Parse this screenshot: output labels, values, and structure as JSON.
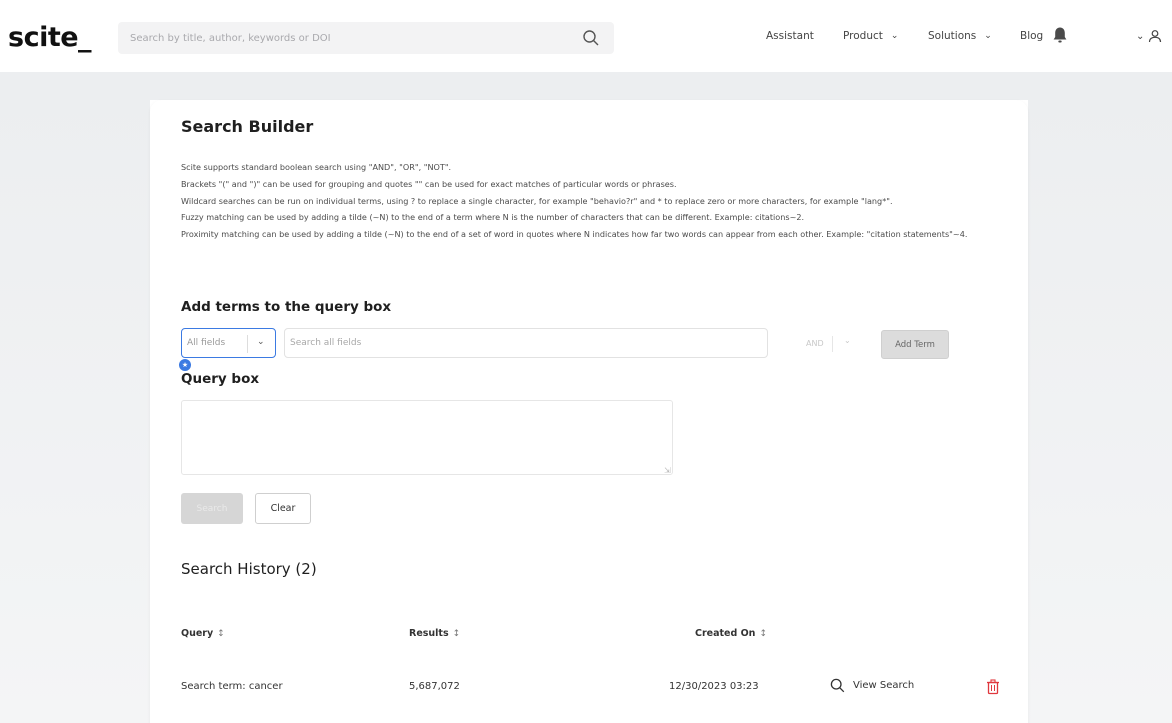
{
  "header": {
    "logo": "scite_",
    "search_placeholder": "Search by title, author, keywords or DOI",
    "nav": [
      {
        "label": "Assistant"
      },
      {
        "label": "Product",
        "chevron": true
      },
      {
        "label": "Solutions",
        "chevron": true
      },
      {
        "label": "Blog"
      }
    ],
    "icons": [
      "search-icon",
      "bell-icon",
      "chevron-down-icon",
      "user-icon"
    ]
  },
  "builder": {
    "title": "Search Builder",
    "help_lines": [
      "Scite supports standard boolean search using \"AND\", \"OR\", \"NOT\".",
      "Brackets \"(\" and \")\" can be used for grouping and quotes \"\" can be used for exact matches of particular words or phrases.",
      "Wildcard searches can be run on individual terms, using ? to replace a single character, for example \"behavio?r\" and * to replace zero or more characters, for example \"lang*\".",
      "Fuzzy matching can be used by adding a tilde (~N) to the end of a term where N is the number of characters that can be different. Example: citations~2.",
      "Proximity matching can be used by adding a tilde (~N) to the end of a set of word in quotes where N indicates how far two words can appear from each other. Example: \"citation statements\"~4."
    ],
    "add_terms_title": "Add terms to the query box",
    "field_select_value": "All fields",
    "term_placeholder": "Search all fields",
    "operator_value": "AND",
    "add_term_label": "Add Term",
    "query_box_title": "Query box",
    "query_box_value": "",
    "search_label": "Search",
    "clear_label": "Clear"
  },
  "history": {
    "title": "Search History (2)",
    "columns": [
      "Query",
      "Results",
      "Created On"
    ],
    "rows": [
      {
        "query": "Search term: cancer",
        "results": "5,687,072",
        "created": "12/30/2023 03:23",
        "action": "View Search"
      }
    ]
  },
  "colors": {
    "accent": "#3b7ae2",
    "danger": "#e0383e"
  }
}
